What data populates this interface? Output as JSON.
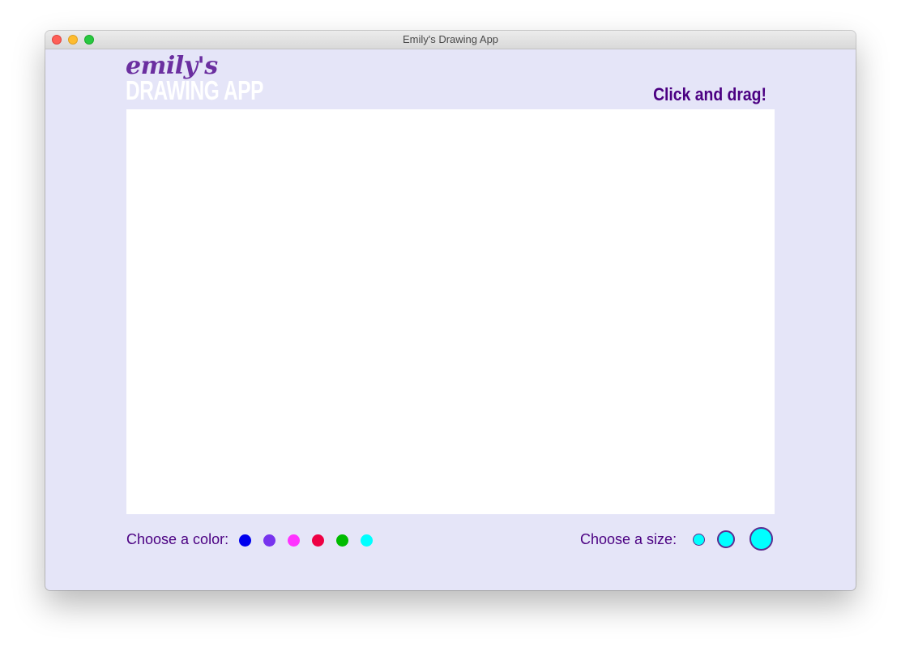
{
  "window": {
    "title": "Emily's Drawing App"
  },
  "header": {
    "logo_script": "emily's",
    "logo_block": "DRAWING APP",
    "hint": "Click and drag!"
  },
  "controls": {
    "color_label": "Choose a color:",
    "size_label": "Choose a size:",
    "colors": [
      "#0000ee",
      "#7733ee",
      "#ff33ff",
      "#ee0044",
      "#00bb00",
      "#00ffff"
    ],
    "selected_color": "#00ffff",
    "sizes": [
      "small",
      "medium",
      "large"
    ]
  },
  "theme": {
    "background": "#e5e5f8",
    "accent": "#4b0082",
    "logo_script_color": "#6b2fa0"
  }
}
